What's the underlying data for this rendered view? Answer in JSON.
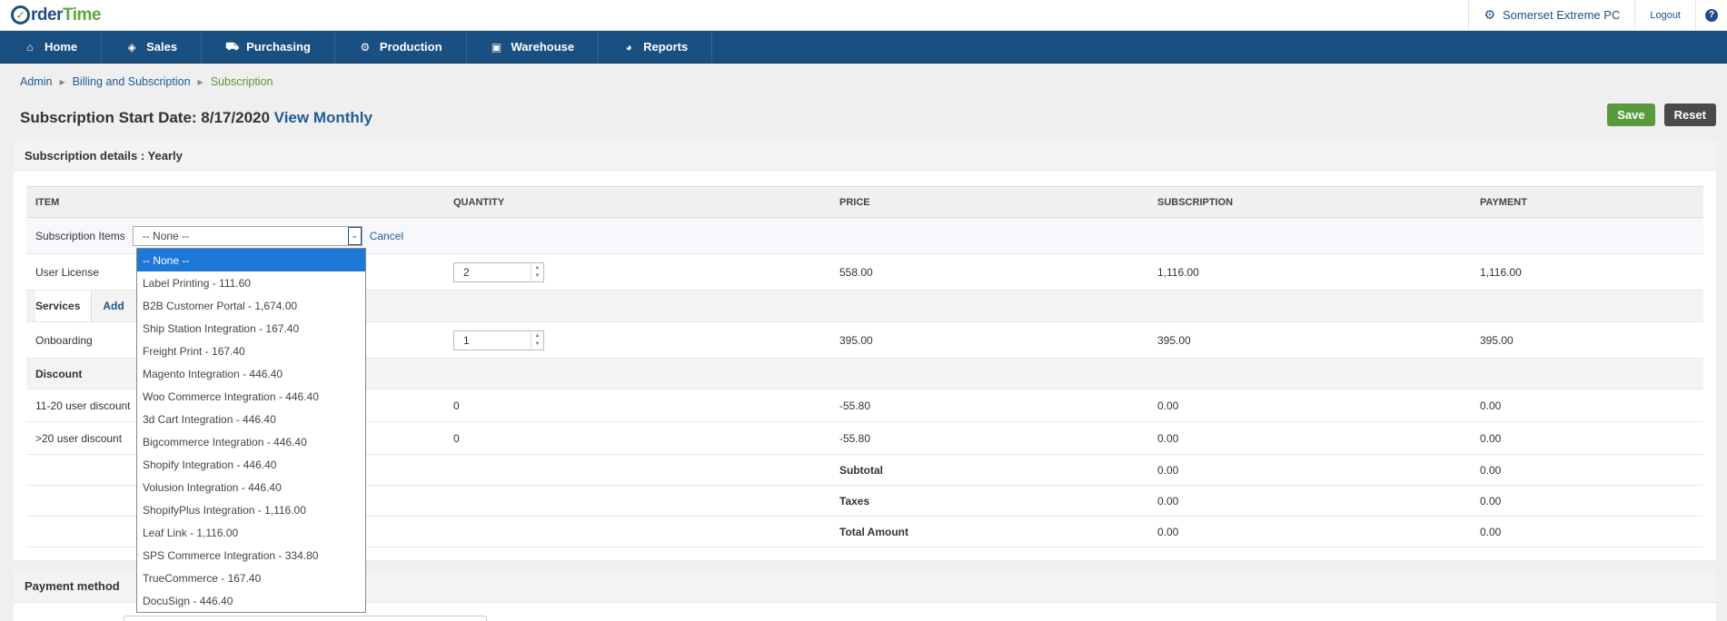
{
  "brand": {
    "part1": "rder",
    "part2": "Time",
    "o_letter": "O"
  },
  "topbar": {
    "company": "Somerset Extreme PC",
    "logout": "Logout",
    "help": "?"
  },
  "nav": [
    {
      "label": "Home",
      "icon": "home-icon"
    },
    {
      "label": "Sales",
      "icon": "tag-icon"
    },
    {
      "label": "Purchasing",
      "icon": "cart-icon"
    },
    {
      "label": "Production",
      "icon": "gears-icon"
    },
    {
      "label": "Warehouse",
      "icon": "box-icon"
    },
    {
      "label": "Reports",
      "icon": "pie-chart-icon"
    }
  ],
  "breadcrumb": [
    "Admin",
    "Billing and Subscription",
    "Subscription"
  ],
  "title": {
    "text": "Subscription Start Date: 8/17/2020",
    "link": "View Monthly"
  },
  "actions": {
    "save": "Save",
    "reset": "Reset"
  },
  "panel": {
    "header": "Subscription details : Yearly",
    "columns": [
      "ITEM",
      "QUANTITY",
      "PRICE",
      "SUBSCRIPTION",
      "PAYMENT"
    ],
    "items_row": {
      "label": "Subscription Items",
      "select_value": "-- None --",
      "cancel": "Cancel"
    },
    "user_license": {
      "item": "User License",
      "qty": "2",
      "price": "558.00",
      "subscription": "1,116.00",
      "payment": "1,116.00"
    },
    "services": {
      "label": "Services",
      "add": "Add"
    },
    "onboarding": {
      "item": "Onboarding",
      "qty": "1",
      "price": "395.00",
      "subscription": "395.00",
      "payment": "395.00"
    },
    "discount": {
      "label": "Discount"
    },
    "discounts": [
      {
        "item": "11-20 user discount",
        "qty": "0",
        "price": "-55.80",
        "subscription": "0.00",
        "payment": "0.00"
      },
      {
        "item": ">20 user discount",
        "qty": "0",
        "price": "-55.80",
        "subscription": "0.00",
        "payment": "0.00"
      }
    ],
    "totals": [
      {
        "label": "Subtotal",
        "subscription": "0.00",
        "payment": "0.00"
      },
      {
        "label": "Taxes",
        "subscription": "0.00",
        "payment": "0.00"
      },
      {
        "label": "Total Amount",
        "subscription": "0.00",
        "payment": "0.00"
      }
    ]
  },
  "dropdown_options": [
    "-- None --",
    "Label Printing - 111.60",
    "B2B Customer Portal - 1,674.00",
    "Ship Station Integration - 167.40",
    "Freight Print - 167.40",
    "Magento Integration - 446.40",
    "Woo Commerce Integration - 446.40",
    "3d Cart Integration - 446.40",
    "Bigcommerce Integration - 446.40",
    "Shopify Integration - 446.40",
    "Volusion Integration - 446.40",
    "ShopifyPlus Integration - 1,116.00",
    "Leaf Link - 1,116.00",
    "SPS Commerce Integration - 334.80",
    "TrueCommerce - 167.40",
    "DocuSign - 446.40"
  ],
  "payment": {
    "header": "Payment method"
  }
}
